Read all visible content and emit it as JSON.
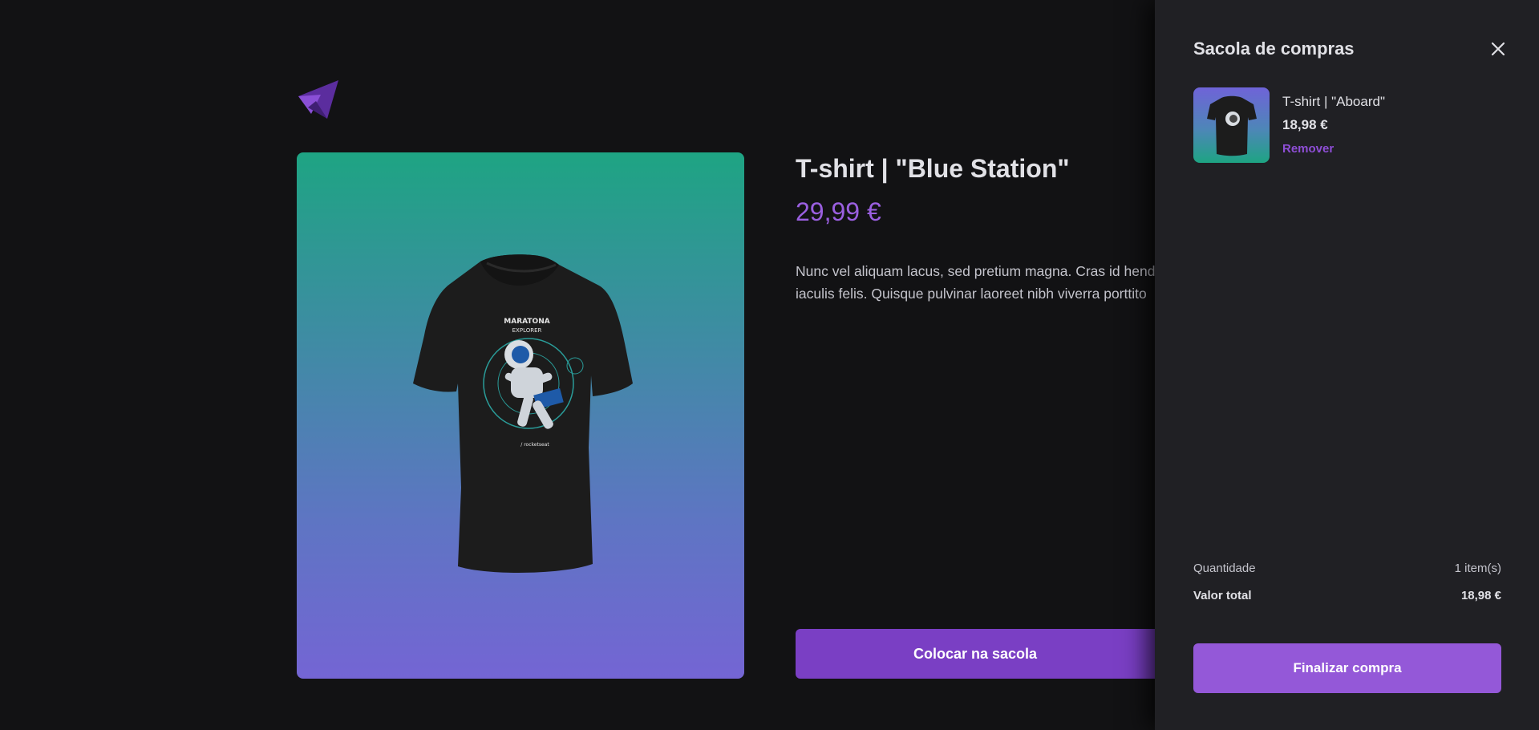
{
  "product": {
    "title": "T-shirt | \"Blue Station\"",
    "price": "29,99 €",
    "description_line1": "Nunc vel aliquam lacus, sed pretium magna. Cras id hend",
    "description_line2": "iaculis felis. Quisque pulvinar laoreet nibh viverra porttito",
    "add_to_bag_label": "Colocar na sacola",
    "print_text_1": "MARATONA",
    "print_text_2": "EXPLORER"
  },
  "cart": {
    "title": "Sacola de compras",
    "items": [
      {
        "name": "T-shirt | \"Aboard\"",
        "price": "18,98 €",
        "remove_label": "Remover"
      }
    ],
    "quantity_label": "Quantidade",
    "quantity_value": "1 item(s)",
    "total_label": "Valor total",
    "total_value": "18,98 €",
    "checkout_label": "Finalizar compra"
  },
  "colors": {
    "background": "#121214",
    "drawer": "#202024",
    "accent": "#8257e5",
    "button": "#7a3fc4",
    "checkout_button": "#9458d8",
    "gradient_top": "#1ea483",
    "gradient_bottom": "#7465d4"
  },
  "icons": {
    "logo": "ignite-shop-logo",
    "close": "close-icon"
  }
}
